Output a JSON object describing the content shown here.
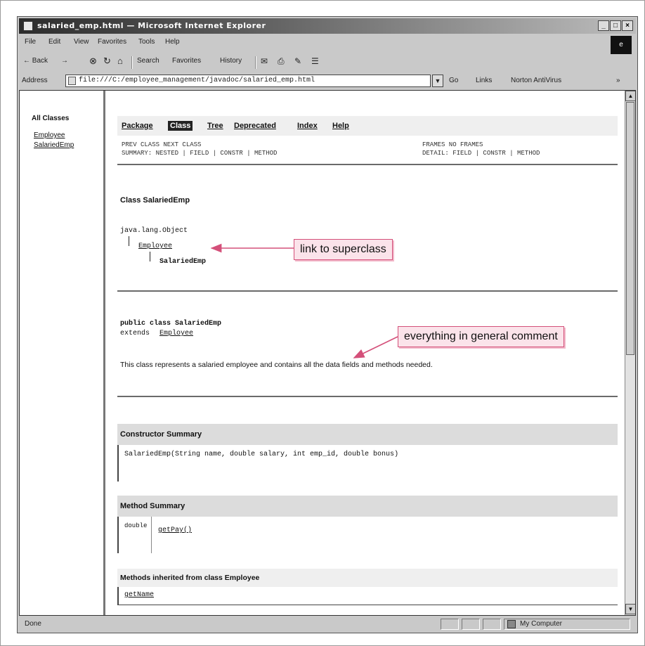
{
  "window": {
    "title": "salaried_emp.html — Microsoft Internet Explorer",
    "throbber": "e"
  },
  "menu": [
    "File",
    "Edit",
    "View",
    "Favorites",
    "Tools",
    "Help"
  ],
  "toolbar": {
    "back": "← Back",
    "forward": "→",
    "stop": "⊗",
    "refresh": "↻",
    "home": "⌂",
    "search": "Search",
    "favorites": "Favorites",
    "history": "History",
    "mail": "✉",
    "print": "⎙",
    "edit": "✎",
    "discuss": "☰"
  },
  "address": {
    "label": "Address",
    "url": "file:///C:/employee_management/javadoc/salaried_emp.html",
    "go": "Go",
    "links": "Links",
    "extra1": "Norton AntiVirus",
    "extra2": "»"
  },
  "left_frame": {
    "title": "All Classes",
    "links": [
      "Employee",
      "SalariedEmp"
    ]
  },
  "nav": {
    "items": [
      "Package",
      "Class",
      "Tree",
      "Deprecated",
      "Index",
      "Help"
    ],
    "prev_class": "PREV CLASS   NEXT CLASS",
    "summary": "SUMMARY: NESTED | FIELD | CONSTR | METHOD",
    "frames": "FRAMES   NO FRAMES",
    "detail": "DETAIL: FIELD | CONSTR | METHOD"
  },
  "class_header": {
    "title": "Class SalariedEmp",
    "tree_root": "java.lang.Object",
    "tree_super": "Employee",
    "tree_self": "SalariedEmp"
  },
  "declaration": {
    "line1": "public class SalariedEmp",
    "line2_prefix": "extends",
    "line2_link": "Employee",
    "comment": "This class represents a salaried employee and contains all the data fields and methods needed."
  },
  "constructor_summary": {
    "title": "Constructor Summary",
    "row": "SalariedEmp(String name, double salary, int emp_id, double bonus)"
  },
  "method_summary": {
    "title": "Method Summary",
    "type": "double",
    "method": "getPay()"
  },
  "inherited": {
    "title": "Methods inherited from class Employee",
    "row": "getName"
  },
  "status": {
    "text": "Done",
    "zone": "My Computer"
  },
  "callouts": {
    "superclass": "link to superclass",
    "general_comment": "everything in general comment"
  }
}
